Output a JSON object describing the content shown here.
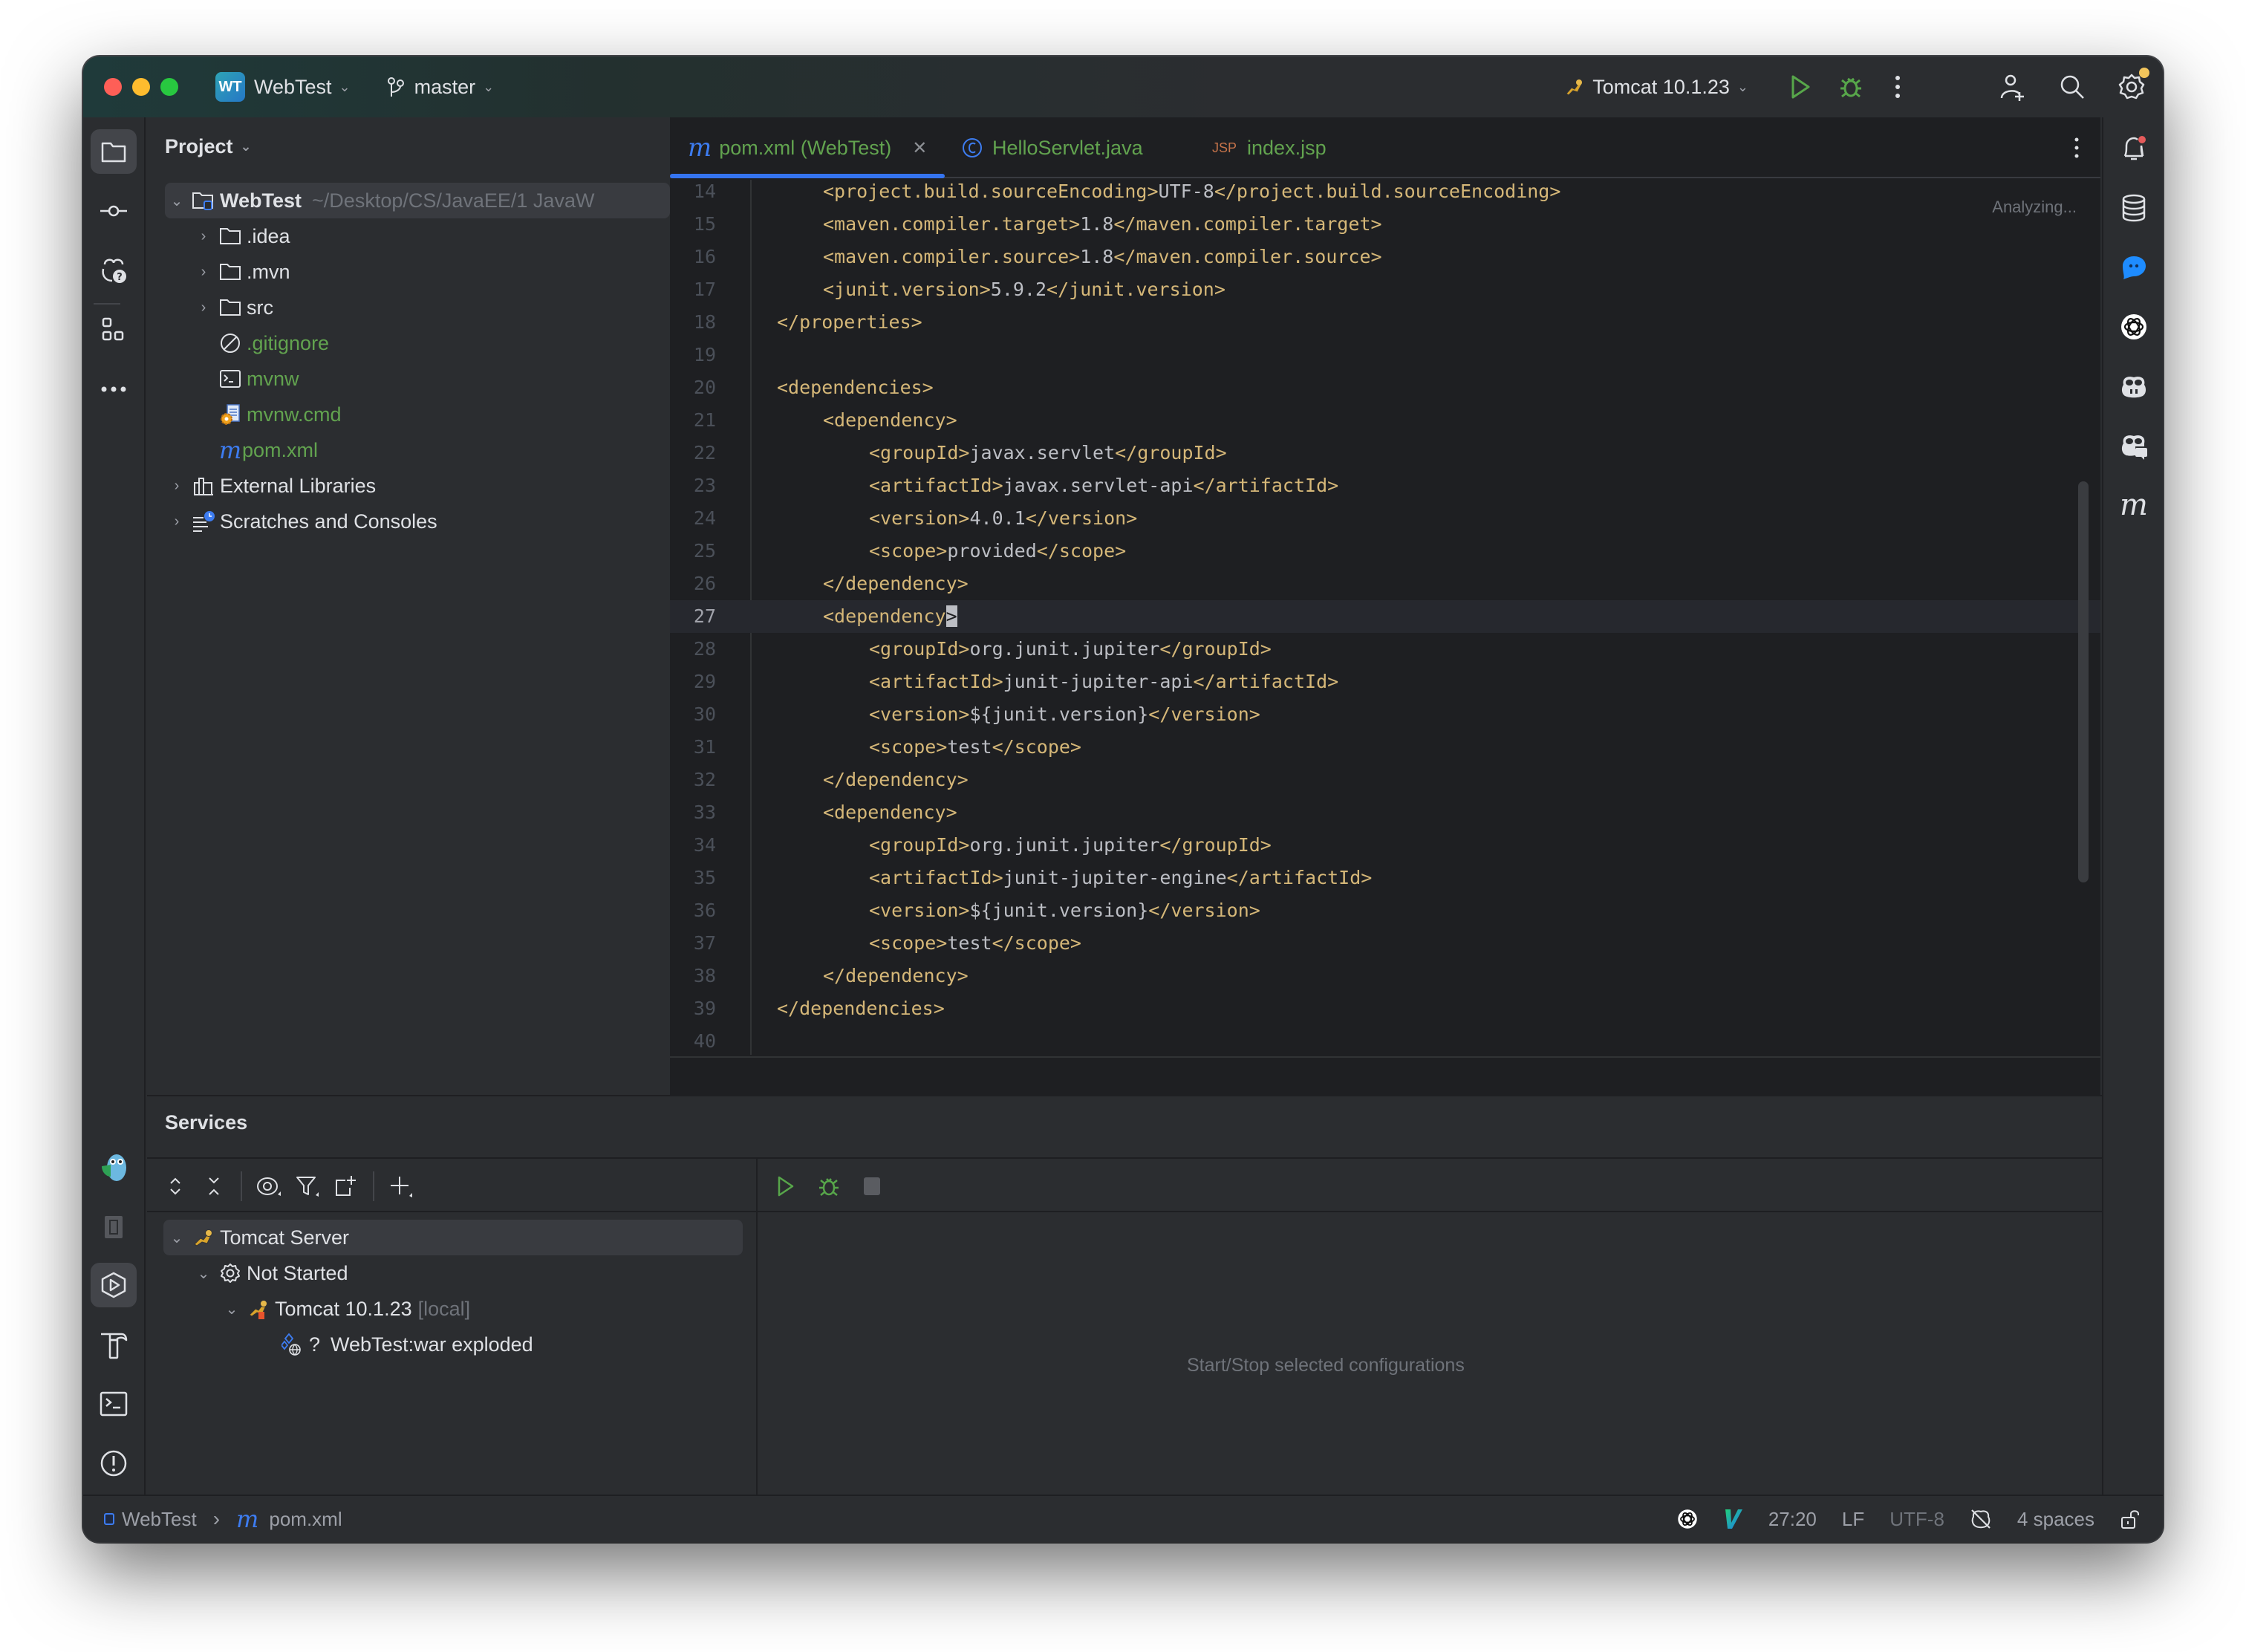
{
  "titlebar": {
    "project_badge": "WT",
    "project_name": "WebTest",
    "branch": "master",
    "run_config": "Tomcat 10.1.23"
  },
  "left_stripe": {
    "icons": [
      "folder-icon",
      "commit-icon",
      "copilot-help-icon",
      "structure-icon",
      "more-icon"
    ],
    "bottom_icons": [
      "gopher-plugin-icon",
      "bookmarks-icon",
      "services-icon",
      "build-icon",
      "terminal-icon",
      "problems-icon",
      "git-icon"
    ]
  },
  "right_stripe": {
    "icons": [
      "notifications-icon",
      "database-icon",
      "chat-icon",
      "openai-icon",
      "copilot-icon",
      "copilot-chat-icon",
      "maven-icon"
    ]
  },
  "project_panel": {
    "title": "Project",
    "tree": [
      {
        "label": "WebTest",
        "path": "~/Desktop/CS/JavaEE/1 JavaW",
        "level": 0,
        "expanded": true,
        "icon": "module-folder-icon",
        "selected": true
      },
      {
        "label": ".idea",
        "level": 1,
        "expanded": false,
        "icon": "folder-icon"
      },
      {
        "label": ".mvn",
        "level": 1,
        "expanded": false,
        "icon": "folder-icon"
      },
      {
        "label": "src",
        "level": 1,
        "expanded": false,
        "icon": "folder-icon"
      },
      {
        "label": ".gitignore",
        "level": 1,
        "icon": "ignore-file-icon",
        "vcs": "added"
      },
      {
        "label": "mvnw",
        "level": 1,
        "icon": "shell-script-icon",
        "vcs": "added"
      },
      {
        "label": "mvnw.cmd",
        "level": 1,
        "icon": "batch-file-icon",
        "vcs": "added"
      },
      {
        "label": "pom.xml",
        "level": 1,
        "icon": "maven-file-icon",
        "vcs": "added"
      },
      {
        "label": "External Libraries",
        "level": 0,
        "expanded": false,
        "icon": "libraries-icon"
      },
      {
        "label": "Scratches and Consoles",
        "level": 0,
        "expanded": false,
        "icon": "scratches-icon"
      }
    ]
  },
  "editor": {
    "tabs": [
      {
        "label": "pom.xml (WebTest)",
        "icon": "maven-file-icon",
        "active": true,
        "closable": true
      },
      {
        "label": "HelloServlet.java",
        "icon": "java-class-icon",
        "active": false
      },
      {
        "label": "index.jsp",
        "icon": "jsp-file-icon",
        "active": false
      }
    ],
    "status_hint": "Analyzing...",
    "current_line": 27,
    "lines": [
      {
        "n": "14",
        "indent": 2,
        "tag_open": "<project.build.sourceEncoding>",
        "value": "UTF-8",
        "tag_close": "</project.build.sourceEncoding>"
      },
      {
        "n": "15",
        "indent": 2,
        "tag_open": "<maven.compiler.target>",
        "value": "1.8",
        "tag_close": "</maven.compiler.target>"
      },
      {
        "n": "16",
        "indent": 2,
        "tag_open": "<maven.compiler.source>",
        "value": "1.8",
        "tag_close": "</maven.compiler.source>"
      },
      {
        "n": "17",
        "indent": 2,
        "tag_open": "<junit.version>",
        "value": "5.9.2",
        "tag_close": "</junit.version>"
      },
      {
        "n": "18",
        "indent": 1,
        "tag_open": "</properties>",
        "value": "",
        "tag_close": ""
      },
      {
        "n": "19",
        "indent": 0,
        "tag_open": "",
        "value": "",
        "tag_close": ""
      },
      {
        "n": "20",
        "indent": 1,
        "tag_open": "<dependencies>",
        "value": "",
        "tag_close": ""
      },
      {
        "n": "21",
        "indent": 2,
        "tag_open": "<dependency>",
        "value": "",
        "tag_close": ""
      },
      {
        "n": "22",
        "indent": 3,
        "tag_open": "<groupId>",
        "value": "javax.servlet",
        "tag_close": "</groupId>"
      },
      {
        "n": "23",
        "indent": 3,
        "tag_open": "<artifactId>",
        "value": "javax.servlet-api",
        "tag_close": "</artifactId>"
      },
      {
        "n": "24",
        "indent": 3,
        "tag_open": "<version>",
        "value": "4.0.1",
        "tag_close": "</version>"
      },
      {
        "n": "25",
        "indent": 3,
        "tag_open": "<scope>",
        "value": "provided",
        "tag_close": "</scope>"
      },
      {
        "n": "26",
        "indent": 2,
        "tag_open": "</dependency>",
        "value": "",
        "tag_close": ""
      },
      {
        "n": "27",
        "indent": 2,
        "tag_open": "<dependency",
        "value": "",
        "tag_close": ">",
        "caret": true
      },
      {
        "n": "28",
        "indent": 3,
        "tag_open": "<groupId>",
        "value": "org.junit.jupiter",
        "tag_close": "</groupId>"
      },
      {
        "n": "29",
        "indent": 3,
        "tag_open": "<artifactId>",
        "value": "junit-jupiter-api",
        "tag_close": "</artifactId>"
      },
      {
        "n": "30",
        "indent": 3,
        "tag_open": "<version>",
        "value": "${junit.version}",
        "tag_close": "</version>"
      },
      {
        "n": "31",
        "indent": 3,
        "tag_open": "<scope>",
        "value": "test",
        "tag_close": "</scope>"
      },
      {
        "n": "32",
        "indent": 2,
        "tag_open": "</dependency>",
        "value": "",
        "tag_close": ""
      },
      {
        "n": "33",
        "indent": 2,
        "tag_open": "<dependency>",
        "value": "",
        "tag_close": ""
      },
      {
        "n": "34",
        "indent": 3,
        "tag_open": "<groupId>",
        "value": "org.junit.jupiter",
        "tag_close": "</groupId>"
      },
      {
        "n": "35",
        "indent": 3,
        "tag_open": "<artifactId>",
        "value": "junit-jupiter-engine",
        "tag_close": "</artifactId>"
      },
      {
        "n": "36",
        "indent": 3,
        "tag_open": "<version>",
        "value": "${junit.version}",
        "tag_close": "</version>"
      },
      {
        "n": "37",
        "indent": 3,
        "tag_open": "<scope>",
        "value": "test",
        "tag_close": "</scope>"
      },
      {
        "n": "38",
        "indent": 2,
        "tag_open": "</dependency>",
        "value": "",
        "tag_close": ""
      },
      {
        "n": "39",
        "indent": 1,
        "tag_open": "</dependencies>",
        "value": "",
        "tag_close": ""
      },
      {
        "n": "40",
        "indent": 0,
        "tag_open": "",
        "value": "",
        "tag_close": ""
      }
    ]
  },
  "services": {
    "title": "Services",
    "toolbar": [
      "expand-all-icon",
      "collapse-all-icon",
      "view-options-icon",
      "filter-icon",
      "new-tab-icon",
      "add-service-icon"
    ],
    "run_toolbar": [
      "run-icon",
      "debug-icon",
      "stop-icon"
    ],
    "tree": [
      {
        "label": "Tomcat Server",
        "level": 0,
        "icon": "tomcat-icon",
        "selected": true
      },
      {
        "label": "Not Started",
        "level": 1,
        "icon": "gear-icon"
      },
      {
        "label": "Tomcat 10.1.23",
        "suffix": "[local]",
        "level": 2,
        "icon": "tomcat-icon"
      },
      {
        "label": "WebTest:war exploded",
        "prefix": "?",
        "level": 3,
        "icon": "artifact-icon"
      }
    ],
    "empty_text": "Start/Stop selected configurations"
  },
  "statusbar": {
    "breadcrumb": [
      "WebTest",
      "pom.xml"
    ],
    "position": "27:20",
    "line_separator": "LF",
    "encoding": "UTF-8",
    "indent": "4 spaces"
  },
  "colors": {
    "accent": "#3574f0",
    "vcs_added": "#62a34f",
    "xml_tag": "#d5b778",
    "run_green": "#57a64a",
    "notification_red": "#e55b5b"
  }
}
